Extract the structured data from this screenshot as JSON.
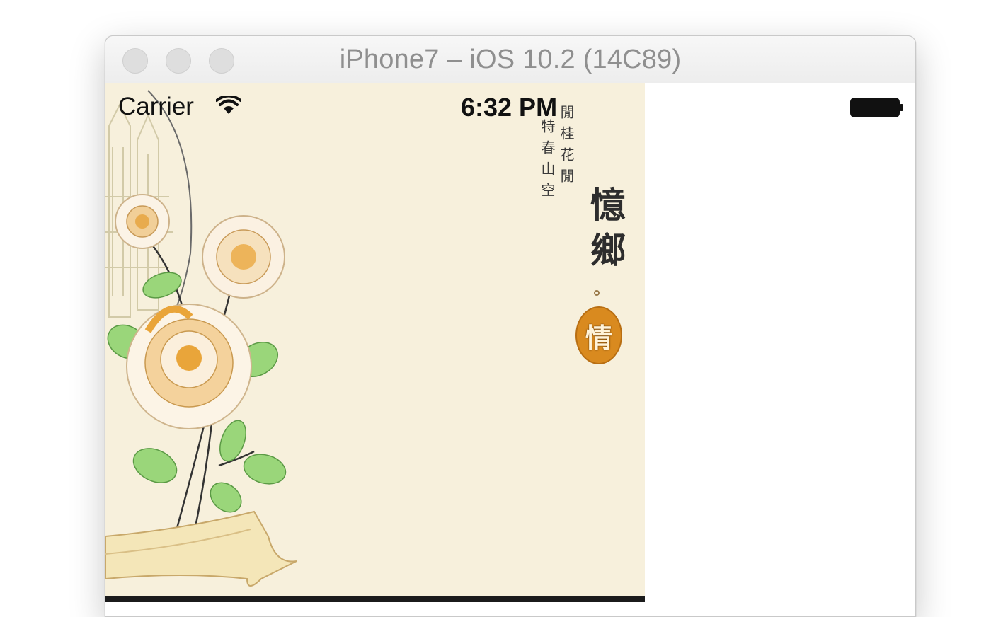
{
  "window": {
    "title": "iPhone7 – iOS 10.2 (14C89)"
  },
  "status_bar": {
    "carrier": "Carrier",
    "time": "6:32 PM",
    "wifi_icon": "wifi-icon",
    "battery_icon": "battery-full-icon"
  },
  "background": {
    "poem_line_1": "特春山空",
    "poem_line_2": "閒桂花閒",
    "big_title": "憶鄉",
    "seal_char": "情",
    "colors": {
      "paper": "#f7f0dc",
      "petal_accent": "#e9a53a",
      "leaf": "#8fcf72",
      "seal": "#d98a1f"
    }
  }
}
